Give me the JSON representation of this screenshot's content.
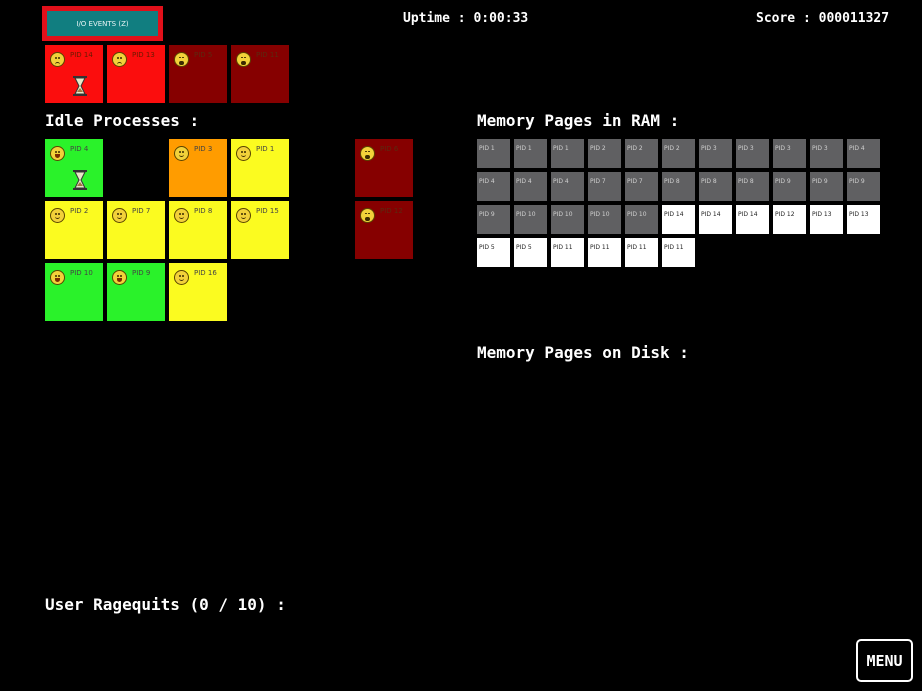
{
  "header": {
    "io_button_label": "I/O EVENTS (Z)",
    "uptime": "Uptime : 0:00:33",
    "score": "Score : 000011327"
  },
  "sections": {
    "idle_title": "Idle Processes :",
    "ram_title": "Memory Pages in RAM :",
    "disk_title": "Memory Pages on Disk :",
    "ragequits": "User Ragequits (0 / 10) :"
  },
  "menu_label": "MENU",
  "colors": {
    "green": "#2af22a",
    "yellow": "#fbfb20",
    "orange": "#ff9c00",
    "red": "#fb0d0d",
    "darkred": "#860000",
    "page_disk": "#606062",
    "page_ram": "#ffffff"
  },
  "cpu_processes": [
    {
      "label": "PID 14",
      "color": "red",
      "face": "sad",
      "waiting": true
    },
    {
      "label": "PID 13",
      "color": "red",
      "face": "sad",
      "waiting": false
    },
    {
      "label": "PID 5",
      "color": "darkred",
      "face": "dead",
      "waiting": false
    },
    {
      "label": "PID 11",
      "color": "darkred",
      "face": "dead",
      "waiting": false
    }
  ],
  "idle_processes": [
    {
      "label": "PID 4",
      "color": "green",
      "face": "happy",
      "waiting": true
    },
    {
      "label": "PID 3",
      "color": "orange",
      "face": "content",
      "waiting": false
    },
    {
      "label": "PID 1",
      "color": "yellow",
      "face": "content",
      "waiting": false
    },
    {
      "label": "PID 6",
      "color": "darkred",
      "face": "dead",
      "waiting": false
    },
    {
      "label": "PID 2",
      "color": "yellow",
      "face": "content",
      "waiting": false
    },
    {
      "label": "PID 7",
      "color": "yellow",
      "face": "content",
      "waiting": false
    },
    {
      "label": "PID 8",
      "color": "yellow",
      "face": "content",
      "waiting": false
    },
    {
      "label": "PID 15",
      "color": "yellow",
      "face": "content",
      "waiting": false
    },
    {
      "label": "PID 12",
      "color": "darkred",
      "face": "dead",
      "waiting": false
    },
    {
      "label": "PID 10",
      "color": "green",
      "face": "happy",
      "waiting": false
    },
    {
      "label": "PID 9",
      "color": "green",
      "face": "happy",
      "waiting": false
    },
    {
      "label": "PID 16",
      "color": "yellow",
      "face": "content",
      "waiting": false
    }
  ],
  "ram_pages": [
    {
      "label": "PID 1",
      "state": "disk"
    },
    {
      "label": "PID 1",
      "state": "disk"
    },
    {
      "label": "PID 1",
      "state": "disk"
    },
    {
      "label": "PID 2",
      "state": "disk"
    },
    {
      "label": "PID 2",
      "state": "disk"
    },
    {
      "label": "PID 2",
      "state": "disk"
    },
    {
      "label": "PID 3",
      "state": "disk"
    },
    {
      "label": "PID 3",
      "state": "disk"
    },
    {
      "label": "PID 3",
      "state": "disk"
    },
    {
      "label": "PID 3",
      "state": "disk"
    },
    {
      "label": "PID 4",
      "state": "disk"
    },
    {
      "label": "PID 4",
      "state": "disk"
    },
    {
      "label": "PID 4",
      "state": "disk"
    },
    {
      "label": "PID 4",
      "state": "disk"
    },
    {
      "label": "PID 7",
      "state": "disk"
    },
    {
      "label": "PID 7",
      "state": "disk"
    },
    {
      "label": "PID 8",
      "state": "disk"
    },
    {
      "label": "PID 8",
      "state": "disk"
    },
    {
      "label": "PID 8",
      "state": "disk"
    },
    {
      "label": "PID 9",
      "state": "disk"
    },
    {
      "label": "PID 9",
      "state": "disk"
    },
    {
      "label": "PID 9",
      "state": "disk"
    },
    {
      "label": "PID 9",
      "state": "disk"
    },
    {
      "label": "PID 10",
      "state": "disk"
    },
    {
      "label": "PID 10",
      "state": "disk"
    },
    {
      "label": "PID 10",
      "state": "disk"
    },
    {
      "label": "PID 10",
      "state": "disk"
    },
    {
      "label": "PID 14",
      "state": "ram"
    },
    {
      "label": "PID 14",
      "state": "ram"
    },
    {
      "label": "PID 14",
      "state": "ram"
    },
    {
      "label": "PID 12",
      "state": "ram"
    },
    {
      "label": "PID 13",
      "state": "ram"
    },
    {
      "label": "PID 13",
      "state": "ram"
    },
    {
      "label": "PID 5",
      "state": "ram"
    },
    {
      "label": "PID 5",
      "state": "ram"
    },
    {
      "label": "PID 11",
      "state": "ram"
    },
    {
      "label": "PID 11",
      "state": "ram"
    },
    {
      "label": "PID 11",
      "state": "ram"
    },
    {
      "label": "PID 11",
      "state": "ram"
    }
  ]
}
